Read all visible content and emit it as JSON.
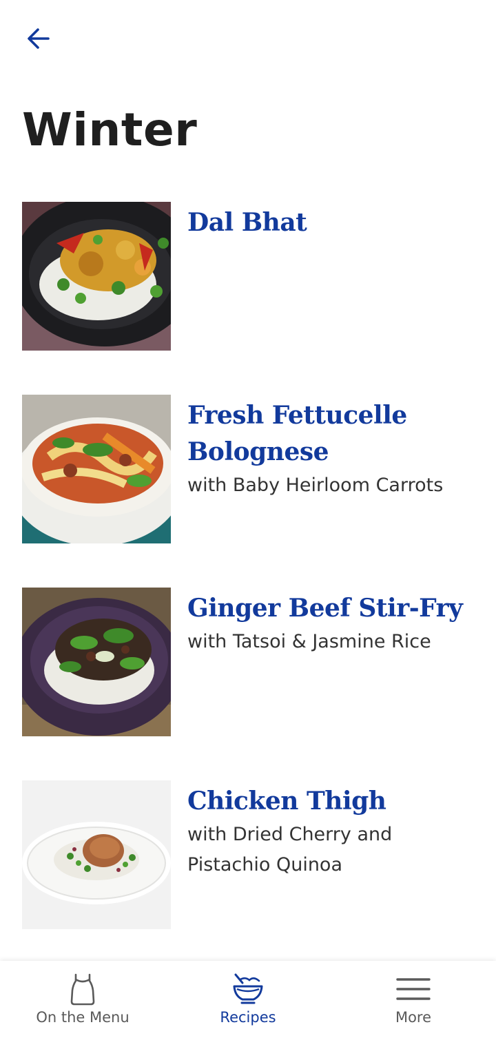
{
  "header": {
    "title": "Winter"
  },
  "recipes": [
    {
      "name": "Dal Bhat",
      "subtitle": ""
    },
    {
      "name": "Fresh Fettucelle Bolognese",
      "subtitle": "with Baby Heirloom Carrots"
    },
    {
      "name": "Ginger Beef Stir-Fry",
      "subtitle": "with Tatsoi & Jasmine Rice"
    },
    {
      "name": "Chicken Thigh",
      "subtitle": "with Dried Cherry and Pistachio Quinoa"
    }
  ],
  "bottom_nav": {
    "items": [
      {
        "label": "On the Menu",
        "icon": "apron-icon",
        "active": false
      },
      {
        "label": "Recipes",
        "icon": "bowl-icon",
        "active": true
      },
      {
        "label": "More",
        "icon": "menu-icon",
        "active": false
      }
    ]
  },
  "colors": {
    "accent": "#123a9c",
    "title": "#1f1f1f",
    "body_text": "#333333",
    "nav_inactive": "#5a5a5a"
  }
}
